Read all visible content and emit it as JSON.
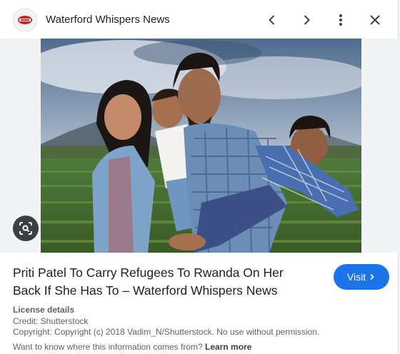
{
  "header": {
    "site_name": "Waterford Whispers News",
    "favicon_icon": "waterford-whispers-logo",
    "prev_icon": "chevron-left-icon",
    "next_icon": "chevron-right-icon",
    "more_icon": "more-vert-icon",
    "close_icon": "close-icon"
  },
  "image": {
    "lens_icon": "lens-search-icon"
  },
  "result": {
    "title": "Priti Patel To Carry Refugees To Rwanda On Her Back If She Has To – Waterford Whispers News",
    "visit_label": "Visit"
  },
  "license": {
    "heading": "License details",
    "credit": "Credit: Shutterstock",
    "copyright": "Copyright: Copyright (c) 2018 Vadim_N/Shutterstock. No use without permission."
  },
  "footer": {
    "question": "Want to know where this information comes from?",
    "learn_more": "Learn more"
  },
  "colors": {
    "accent": "#1a73e8",
    "text": "#202124",
    "secondary": "#5f6368"
  }
}
